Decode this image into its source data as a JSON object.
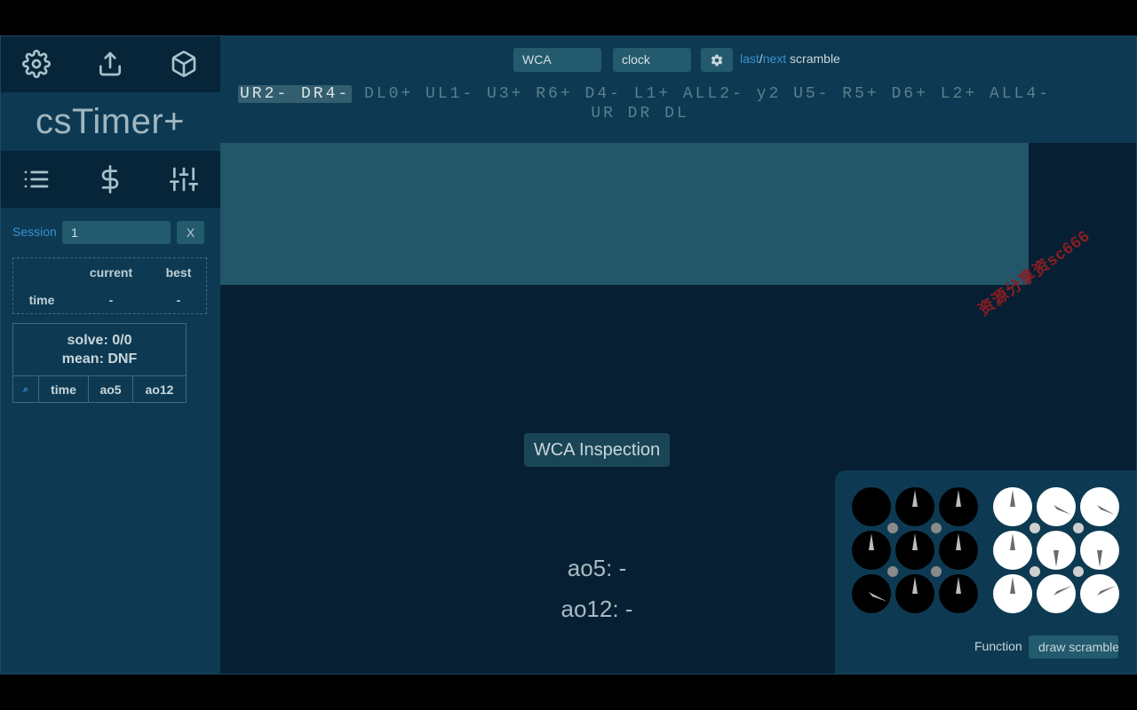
{
  "sidebar": {
    "top_icons": [
      "gear-icon",
      "export-icon",
      "cube-icon"
    ],
    "logo": "csTimer+",
    "bottom_icons": [
      "list-icon",
      "dollar-icon",
      "sliders-icon"
    ],
    "session_label": "Session",
    "session_value": "1",
    "session_close": "X",
    "stats": {
      "headers": [
        "current",
        "best"
      ],
      "row_label": "time",
      "current": "-",
      "best": "-"
    },
    "solves": {
      "summary_solve": "solve: 0/0",
      "summary_mean": "mean: DNF",
      "columns": [
        "⌕",
        "time",
        "ao5",
        "ao12"
      ]
    }
  },
  "topbar": {
    "event_group": "WCA",
    "event": "clock",
    "nav_last": "last",
    "nav_sep": "/",
    "nav_next": "next",
    "nav_suffix": " scramble",
    "scramble_highlight": "UR2- DR4-",
    "scramble_rest": " DL0+ UL1- U3+ R6+ D4- L1+ ALL2- y2 U5- R5+ D6+ L2+ ALL4-",
    "scramble_line2": "UR DR DL"
  },
  "watermark": "资源分享资sc666",
  "timer": {
    "inspection": "WCA Inspection",
    "ao5": "ao5: -",
    "ao12": "ao12: -"
  },
  "tool": {
    "function_label": "Function",
    "function_value": "draw scramble"
  },
  "colors": {
    "accent_link": "#3a8fd1",
    "sidebar": "#0d3a52",
    "main_bg": "#061f33"
  }
}
